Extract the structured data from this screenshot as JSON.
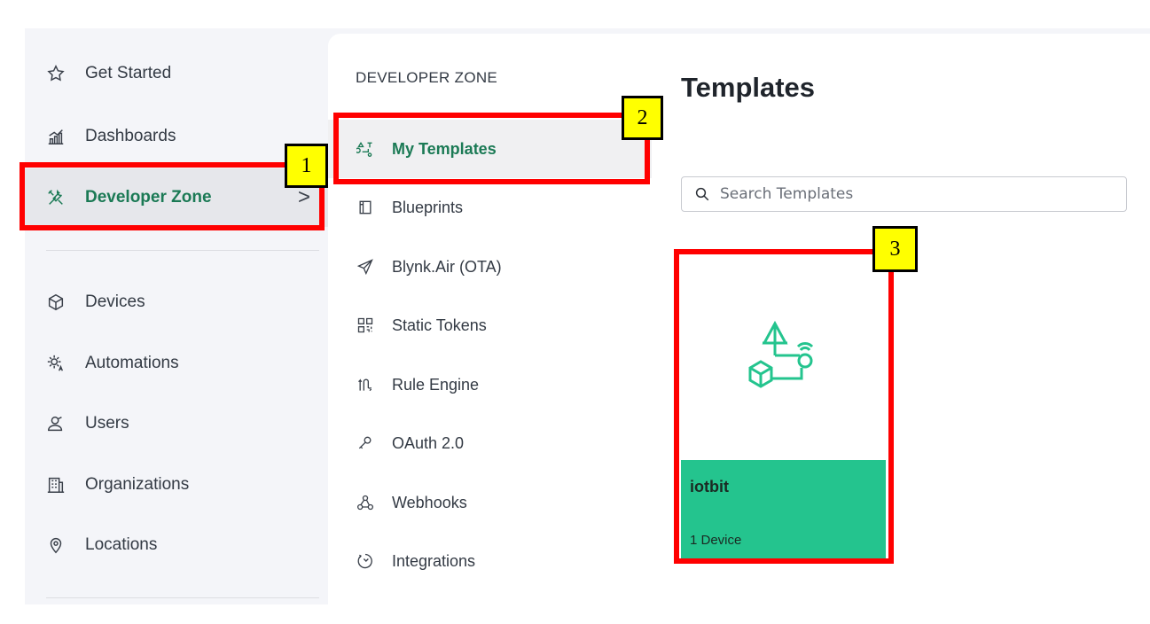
{
  "sidebar": {
    "items": [
      {
        "label": "Get Started",
        "icon": "star-icon"
      },
      {
        "label": "Dashboards",
        "icon": "bar-chart-icon"
      },
      {
        "label": "Developer Zone",
        "icon": "tools-icon",
        "active": true
      },
      {
        "label": "Devices",
        "icon": "cube-icon"
      },
      {
        "label": "Automations",
        "icon": "sun-automation-icon"
      },
      {
        "label": "Users",
        "icon": "users-icon"
      },
      {
        "label": "Organizations",
        "icon": "building-icon"
      },
      {
        "label": "Locations",
        "icon": "location-pin-icon"
      }
    ],
    "chevron": ">"
  },
  "developer_zone": {
    "heading": "DEVELOPER ZONE",
    "items": [
      {
        "label": "My Templates",
        "icon": "templates-icon",
        "active": true
      },
      {
        "label": "Blueprints",
        "icon": "book-icon"
      },
      {
        "label": "Blynk.Air (OTA)",
        "icon": "paper-plane-icon"
      },
      {
        "label": "Static Tokens",
        "icon": "qr-code-icon"
      },
      {
        "label": "Rule Engine",
        "icon": "rule-engine-icon"
      },
      {
        "label": "OAuth 2.0",
        "icon": "key-icon"
      },
      {
        "label": "Webhooks",
        "icon": "webhook-icon"
      },
      {
        "label": "Integrations",
        "icon": "integrations-icon"
      }
    ]
  },
  "main": {
    "title": "Templates",
    "search_placeholder": "Search Templates",
    "cards": [
      {
        "name": "iotbit",
        "device_count": "1 Device"
      }
    ]
  },
  "annotations": [
    "1",
    "2",
    "3"
  ],
  "colors": {
    "accent": "#1b7a55",
    "card_footer": "#24c48e",
    "highlight": "#ff0000",
    "tag_bg": "#ffff00"
  }
}
